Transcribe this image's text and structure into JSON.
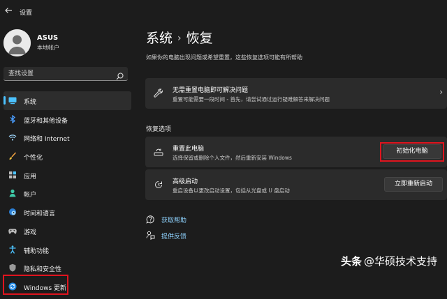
{
  "window": {
    "title": "设置"
  },
  "user": {
    "name": "ASUS",
    "account_type": "本地帐户"
  },
  "search": {
    "placeholder": "查找设置"
  },
  "sidebar": {
    "items": [
      {
        "label": "系统",
        "icon": "monitor-icon",
        "active": true
      },
      {
        "label": "蓝牙和其他设备",
        "icon": "bluetooth-icon"
      },
      {
        "label": "网络和 Internet",
        "icon": "wifi-icon"
      },
      {
        "label": "个性化",
        "icon": "brush-icon"
      },
      {
        "label": "应用",
        "icon": "apps-icon"
      },
      {
        "label": "帐户",
        "icon": "person-icon"
      },
      {
        "label": "时间和语言",
        "icon": "globe-clock-icon"
      },
      {
        "label": "游戏",
        "icon": "gamepad-icon"
      },
      {
        "label": "辅助功能",
        "icon": "accessibility-icon"
      },
      {
        "label": "隐私和安全性",
        "icon": "shield-icon"
      },
      {
        "label": "Windows 更新",
        "icon": "windows-update-icon"
      }
    ]
  },
  "main": {
    "breadcrumb_parent": "系统",
    "breadcrumb_sep": "›",
    "page_title": "恢复",
    "subtitle": "如果你的电脑出现问题或希望重置，这些恢复选项可能有所帮助",
    "fix_card": {
      "title": "无需重置电脑即可解决问题",
      "desc": "重置可能需要一段时间 - 首先，请尝试通过运行疑难解答来解决问题",
      "chevron": "›"
    },
    "section_title": "恢复选项",
    "reset_card": {
      "title": "重置此电脑",
      "desc": "选择保留或删除个人文件，然后重新安装 Windows",
      "button": "初始化电脑"
    },
    "advanced_card": {
      "title": "高级启动",
      "desc": "重启设备以更改启动设置，包括从光盘或 U 盘启动",
      "button": "立即重新启动"
    },
    "links": {
      "help": "获取帮助",
      "feedback": "提供反馈"
    }
  },
  "watermark": {
    "brand": "头条",
    "text": "@华硕技术支持"
  },
  "colors": {
    "accent": "#4cc2ff",
    "highlight_box": "#e0141e",
    "link": "#8fd3ff"
  }
}
